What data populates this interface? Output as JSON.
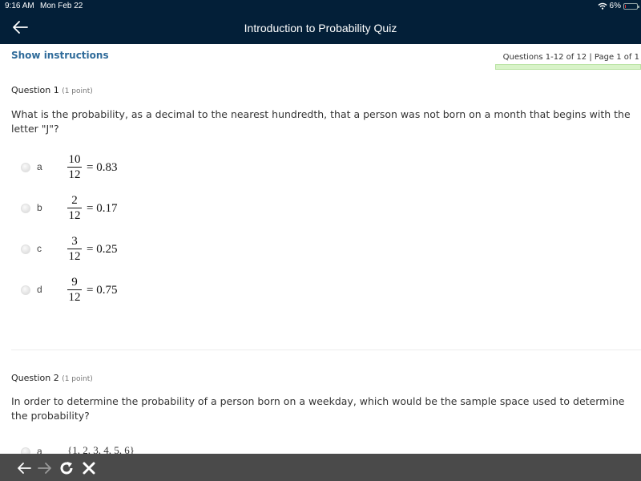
{
  "status_bar": {
    "time": "9:16 AM",
    "date": "Mon Feb 22",
    "battery": "6%",
    "wifi_icon": "wifi-icon",
    "battery_icon": "battery-icon"
  },
  "header": {
    "title": "Introduction to Probability Quiz",
    "back_icon": "arrow-left-icon"
  },
  "instructions_link": "Show instructions",
  "pager": {
    "label": "Questions 1-12 of 12 | Page 1 of 1",
    "progress_percent": 100
  },
  "questions": [
    {
      "heading": "Question 1",
      "points": "(1 point)",
      "text": "What is the probability, as a decimal to the nearest hundredth, that a person was not born on a month that begins with the letter \"J\"?",
      "options": [
        {
          "letter": "a",
          "numerator": "10",
          "denominator": "12",
          "result": "= 0.83"
        },
        {
          "letter": "b",
          "numerator": "2",
          "denominator": "12",
          "result": "= 0.17"
        },
        {
          "letter": "c",
          "numerator": "3",
          "denominator": "12",
          "result": "= 0.25"
        },
        {
          "letter": "d",
          "numerator": "9",
          "denominator": "12",
          "result": "= 0.75"
        }
      ]
    },
    {
      "heading": "Question 2",
      "points": "(1 point)",
      "text": "In order to determine the probability of a person born on a weekday, which would be the sample space used to determine the probability?",
      "options": [
        {
          "letter": "a",
          "value": "{1, 2, 3, 4, 5, 6}"
        }
      ]
    }
  ],
  "browser_toolbar": {
    "back_icon": "arrow-left-icon",
    "forward_icon": "arrow-right-icon",
    "reload_icon": "reload-icon",
    "close_icon": "close-icon"
  }
}
